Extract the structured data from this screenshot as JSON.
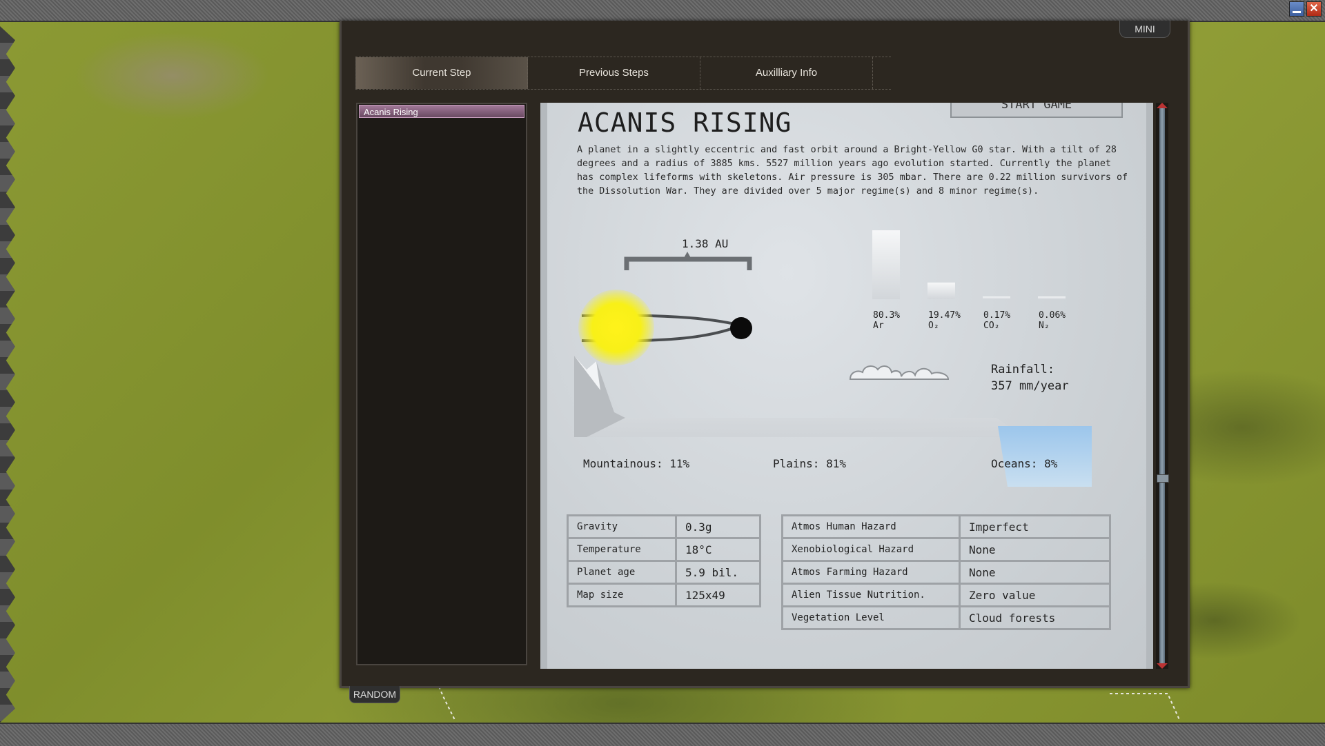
{
  "window": {
    "minimize_icon": "minimize-icon",
    "close_icon": "close-icon",
    "close_glyph": "✕"
  },
  "mini_button": "MINI",
  "random_button": "RANDOM",
  "tabs": [
    {
      "label": "Current Step"
    },
    {
      "label": "Previous Steps"
    },
    {
      "label": "Auxilliary Info"
    }
  ],
  "sidebar": {
    "items": [
      {
        "label": "Acanis Rising",
        "selected": true
      }
    ]
  },
  "start_button": "START GAME",
  "planet": {
    "name": "ACANIS RISING",
    "description": "A planet in a slightly eccentric and fast orbit around a Bright-Yellow G0 star. With a tilt of 28 degrees and a radius of 3885 kms. 5527 million years ago evolution started. Currently the planet has complex lifeforms with skeletons. Air pressure is 305 mbar. There are 0.22 million survivors of the Dissolution War. They are divided over 5 major regime(s) and 8 minor regime(s).",
    "orbit_distance": "1.38 AU",
    "atmosphere": [
      {
        "percent": "80.3%",
        "percent_value": 80.3,
        "gas": "Ar"
      },
      {
        "percent": "19.47%",
        "percent_value": 19.47,
        "gas": "O₂"
      },
      {
        "percent": "0.17%",
        "percent_value": 0.17,
        "gas": "CO₂"
      },
      {
        "percent": "0.06%",
        "percent_value": 0.06,
        "gas": "N₂"
      }
    ],
    "rainfall_label": "Rainfall:",
    "rainfall_value": "357 mm/year",
    "terrain": {
      "mountainous": "Mountainous: 11%",
      "plains": "Plains: 81%",
      "oceans": "Oceans: 8%"
    }
  },
  "stats": [
    {
      "key": "Gravity",
      "value": "0.3g"
    },
    {
      "key": "Temperature",
      "value": "18°C"
    },
    {
      "key": "Planet age",
      "value": "5.9 bil."
    },
    {
      "key": "Map size",
      "value": "125x49"
    }
  ],
  "hazards": [
    {
      "key": "Atmos Human Hazard",
      "value": "Imperfect"
    },
    {
      "key": "Xenobiological Hazard",
      "value": "None"
    },
    {
      "key": "Atmos Farming Hazard",
      "value": "None"
    },
    {
      "key": "Alien Tissue Nutrition.",
      "value": "Zero value"
    },
    {
      "key": "Vegetation Level",
      "value": "Cloud forests"
    }
  ],
  "colors": {
    "sun": "#f8f018",
    "panel": "#2c2720",
    "selected_item": "#8f6a86",
    "ocean": "#7fb0de"
  }
}
